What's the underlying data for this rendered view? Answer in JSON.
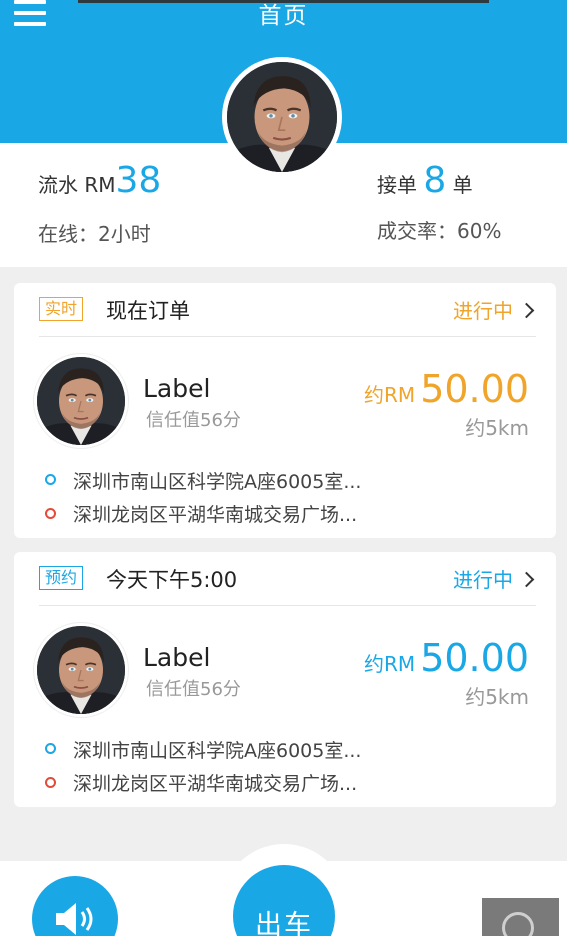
{
  "header": {
    "title": "首页"
  },
  "colors": {
    "primary": "#1aa7e6",
    "accent_orange": "#f0a42a",
    "dot_start": "#1aa7e6",
    "dot_end": "#e24a3a"
  },
  "stats": {
    "flow_label": "流水 RM",
    "flow_value": "38",
    "orders_label": "接单",
    "orders_value": "8",
    "orders_unit": "单",
    "online": "在线：2小时",
    "success_rate": "成交率：60%"
  },
  "orders": [
    {
      "tag": "实时",
      "title": "现在订单",
      "status": "进行中",
      "name": "Label",
      "trust": "信任值56分",
      "price_prefix": "约RM",
      "price": "50.00",
      "distance": "约5km",
      "from": "深圳市南山区科学院A座6005室...",
      "to": "深圳龙岗区平湖华南城交易广场..."
    },
    {
      "tag": "预约",
      "title": "今天下午5:00",
      "status": "进行中",
      "name": "Label",
      "trust": "信任值56分",
      "price_prefix": "约RM",
      "price": "50.00",
      "distance": "约5km",
      "from": "深圳市南山区科学院A座6005室...",
      "to": "深圳龙岗区平湖华南城交易广场..."
    }
  ],
  "bottom": {
    "go_label": "出车",
    "sound_icon": "speaker-icon",
    "float_icon": "add-circle-icon"
  }
}
